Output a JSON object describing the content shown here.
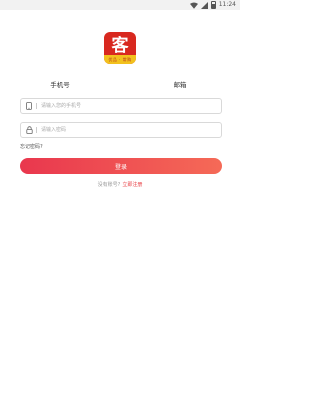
{
  "status_bar": {
    "time": "11:24"
  },
  "logo": {
    "char": "客",
    "sub_text": "优品 · 常购"
  },
  "tabs": [
    {
      "label": "手机号"
    },
    {
      "label": "邮箱"
    }
  ],
  "phone_field": {
    "placeholder": "请输入您的手机号",
    "value": ""
  },
  "password_field": {
    "placeholder": "请输入密码",
    "value": ""
  },
  "forgot_password": "忘记密码?",
  "login_button": "登录",
  "register": {
    "prompt": "没有账号?",
    "link": "立即注册"
  },
  "colors": {
    "brand_red": "#d8281f",
    "button_gradient_start": "#e9374e",
    "button_gradient_end": "#f56a57",
    "link_red": "#e83a3f"
  }
}
